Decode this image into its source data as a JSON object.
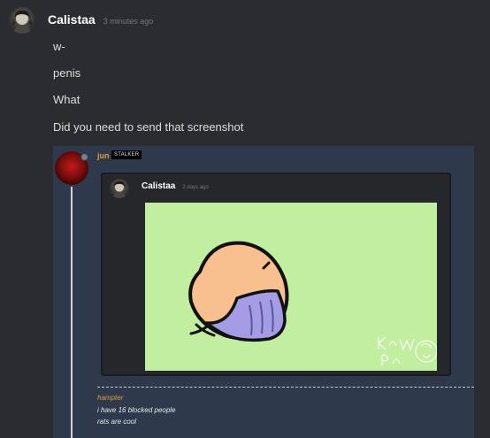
{
  "message": {
    "author": "Calistaa",
    "timestamp": "3 minutes ago",
    "lines": [
      "w-",
      "penis",
      "What",
      "Did you need to send that screenshot"
    ]
  },
  "screenshot": {
    "author": "jun",
    "role": "STALKER",
    "inner_message": {
      "author": "Calistaa",
      "timestamp": "2 days ago",
      "drawing_signature": "Kawa Pains"
    },
    "quoted": {
      "name": "hampter",
      "lines": [
        "i have 16 blocked people",
        "rats are cool"
      ]
    }
  },
  "colors": {
    "background": "#2b2c31",
    "embed_background": "#2e3a4b",
    "drawing_background": "#c2eea0",
    "username_orange": "#e39a3b"
  }
}
